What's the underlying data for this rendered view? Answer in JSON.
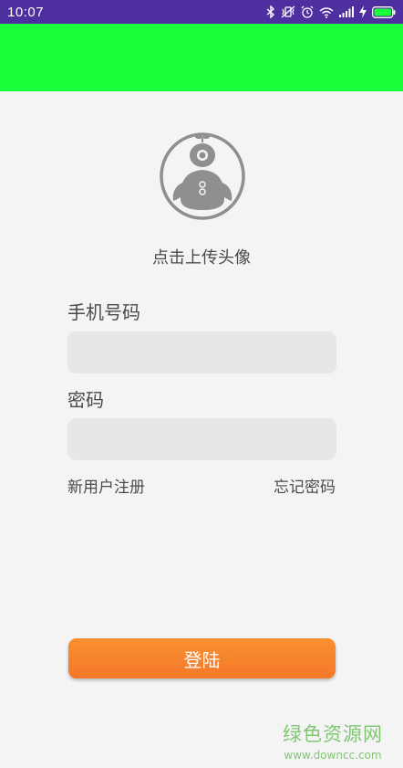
{
  "status_bar": {
    "time": "10:07",
    "background": "#4d2fa0",
    "icons": [
      "bluetooth-icon",
      "vibrate-icon",
      "alarm-icon",
      "wifi-icon",
      "signal-icon",
      "charging-icon",
      "battery-icon"
    ]
  },
  "header": {
    "background": "#19ff3a"
  },
  "avatar": {
    "icon": "robot-avatar-icon",
    "caption": "点击上传头像"
  },
  "form": {
    "phone_label": "手机号码",
    "phone_value": "",
    "password_label": "密码",
    "password_value": ""
  },
  "links": {
    "register": "新用户注册",
    "forgot_password": "忘记密码"
  },
  "login_button": {
    "label": "登陆",
    "color": "#f6822c"
  },
  "watermark": {
    "title": "绿色资源网",
    "url": "www.downcc.com"
  }
}
